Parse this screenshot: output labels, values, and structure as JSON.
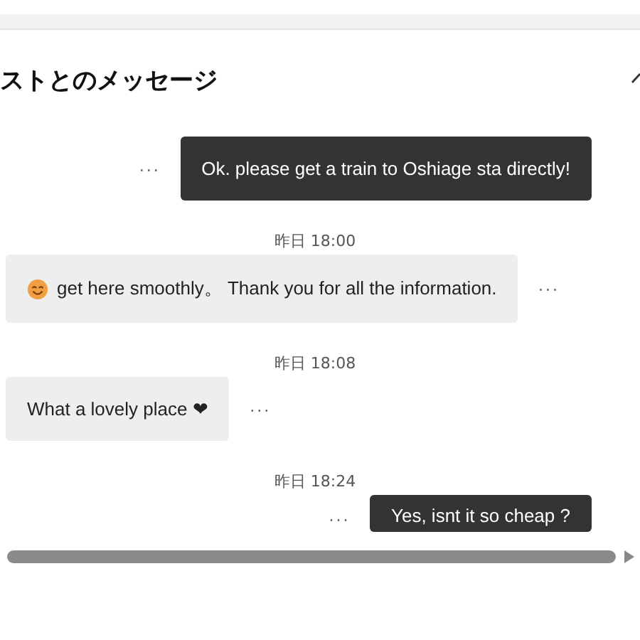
{
  "header": {
    "title": "ストとのメッセージ"
  },
  "messages": [
    {
      "kind": "sent",
      "text": "Ok. please get a train to Oshiage sta directly!",
      "more": "···"
    },
    {
      "kind": "time",
      "text": "昨日 18:00"
    },
    {
      "kind": "received",
      "emoji": true,
      "text": "get here smoothly。 Thank you for all the information.",
      "more": "···"
    },
    {
      "kind": "time",
      "text": "昨日 18:08"
    },
    {
      "kind": "received",
      "emoji": false,
      "text": "What a lovely place ❤",
      "more": "···"
    },
    {
      "kind": "time",
      "text": "昨日 18:24"
    },
    {
      "kind": "sent",
      "text": "Yes, isnt it so cheap ?",
      "more": "···"
    }
  ]
}
